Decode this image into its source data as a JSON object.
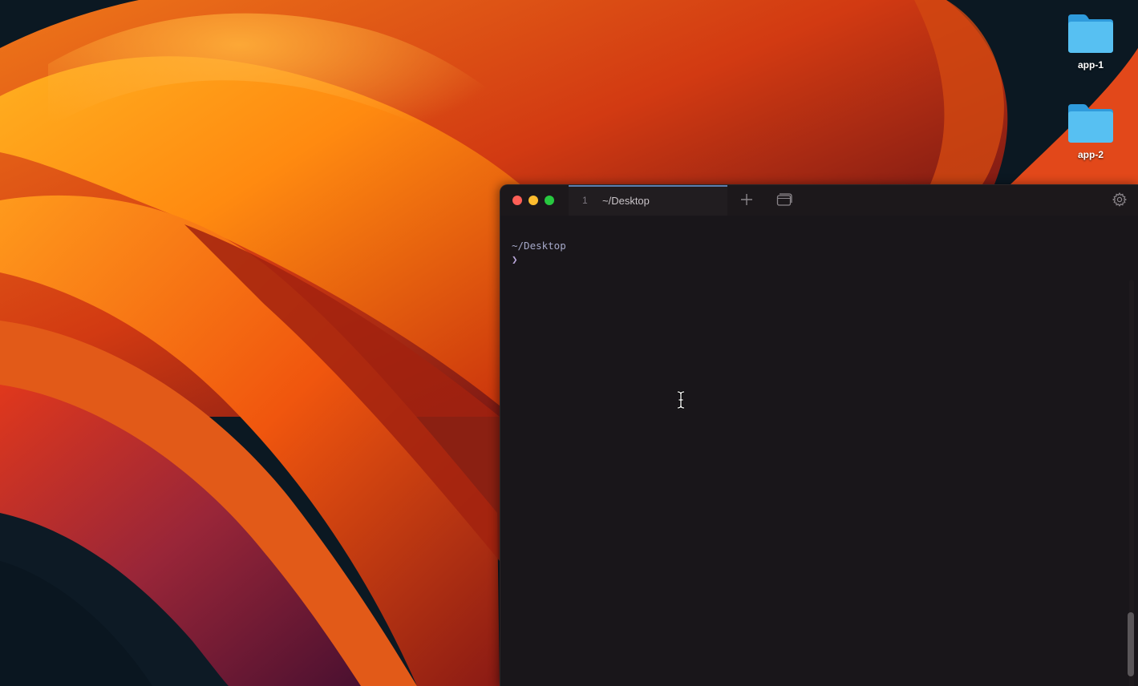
{
  "desktop": {
    "icons": [
      {
        "label": "app-1",
        "icon": "folder-icon"
      },
      {
        "label": "app-2",
        "icon": "folder-icon"
      }
    ]
  },
  "terminal": {
    "tab": {
      "index": "1",
      "title": "~/Desktop"
    },
    "buttons": {
      "new_tab": "plus-icon",
      "tab_overview": "tabs-overview-icon",
      "settings": "gear-icon"
    },
    "lines": {
      "cwd": "~/Desktop",
      "prompt": "❯"
    },
    "colors": {
      "background": "#19161a",
      "cwd_text": "#a6a9c9",
      "prompt": "#b8a6d9",
      "tab_accent": "#5b7fae"
    }
  }
}
